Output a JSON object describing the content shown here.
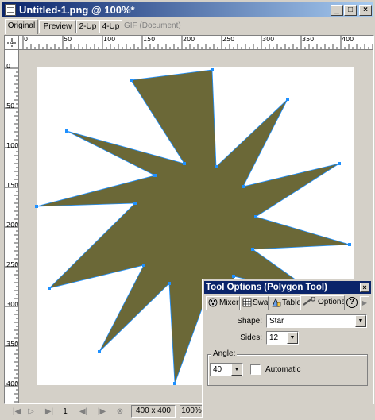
{
  "window": {
    "title": "Untitled-1.png @ 100%*",
    "minimize": "_",
    "maximize": "□",
    "close": "×"
  },
  "view_tabs": [
    {
      "label": "Original"
    },
    {
      "label": "Preview"
    },
    {
      "label": "2-Up"
    },
    {
      "label": "4-Up"
    },
    {
      "label": "GIF (Document)"
    }
  ],
  "rulers": {
    "horizontal_labels": [
      "0",
      "50",
      "100",
      "150",
      "200",
      "250",
      "300",
      "350",
      "400"
    ],
    "vertical_labels": [
      "0",
      "50",
      "100",
      "150",
      "200",
      "250",
      "300",
      "350",
      "400"
    ]
  },
  "canvas": {
    "shape_fill": "#6b6837",
    "point_color": "#1e90ff",
    "background": "#ffffff"
  },
  "status": {
    "frame": "1",
    "size": "400 x 400",
    "zoom": "100%"
  },
  "panel": {
    "title": "Tool Options (Polygon Tool)",
    "close": "×",
    "help": "?",
    "tabs": [
      {
        "label": "Mixer",
        "icon": "mixer-icon"
      },
      {
        "label": "Swatches",
        "icon": "swatches-icon"
      },
      {
        "label": "Tables",
        "icon": "tables-icon"
      },
      {
        "label": "Options",
        "icon": "options-icon"
      }
    ],
    "shape_label": "Shape:",
    "shape_value": "Star",
    "sides_label": "Sides:",
    "sides_value": "12",
    "angle_label": "Angle:",
    "angle_value": "40",
    "automatic_label": "Automatic",
    "automatic_checked": false
  }
}
